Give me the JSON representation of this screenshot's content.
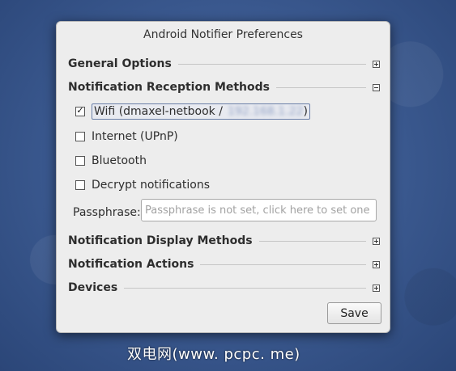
{
  "window": {
    "title": "Android Notifier Preferences"
  },
  "sections": {
    "general": {
      "label": "General Options",
      "expanded": false
    },
    "reception": {
      "label": "Notification Reception Methods",
      "expanded": true
    },
    "display": {
      "label": "Notification Display Methods",
      "expanded": false
    },
    "actions": {
      "label": "Notification Actions",
      "expanded": false
    },
    "devices": {
      "label": "Devices",
      "expanded": false
    }
  },
  "reception_options": {
    "wifi": {
      "label_prefix": "Wifi (dmaxel-netbook / ",
      "label_redacted": "192.168.1.22",
      "label_suffix": ")",
      "checked": true
    },
    "internet": {
      "label": "Internet (UPnP)",
      "checked": false
    },
    "bluetooth": {
      "label": "Bluetooth",
      "checked": false
    },
    "decrypt": {
      "label": "Decrypt notifications",
      "checked": false
    }
  },
  "passphrase": {
    "label": "Passphrase:",
    "placeholder": "Passphrase is not set, click here to set one"
  },
  "buttons": {
    "save": "Save"
  },
  "watermark": "双电网(www. pcpc. me)",
  "colors": {
    "desktop": "#3d5c93",
    "dialog": "#ededed",
    "focus_border": "#6a7fa8"
  }
}
